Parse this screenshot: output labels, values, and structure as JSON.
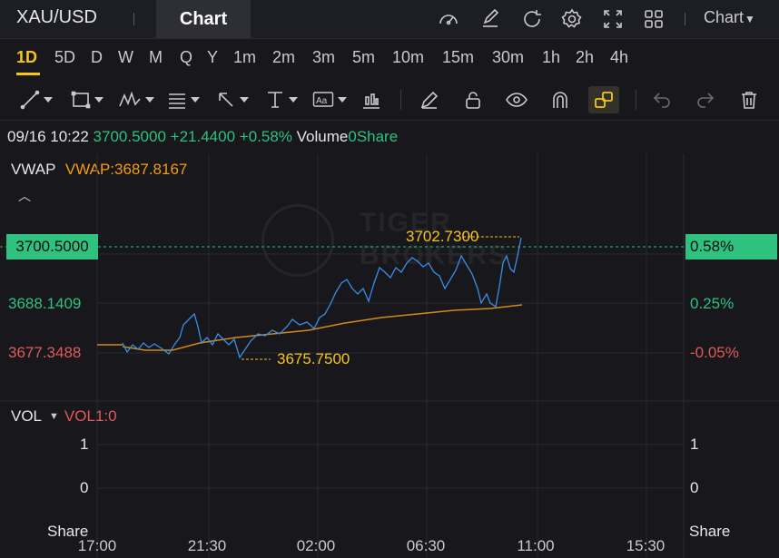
{
  "header": {
    "symbol": "XAU/USD",
    "active_tab": "Chart",
    "chart_menu": "Chart",
    "icons": [
      "gauge-icon",
      "edit-icon",
      "refresh-icon",
      "settings-icon",
      "fullscreen-icon",
      "layout-grid-icon"
    ]
  },
  "timeframes": [
    "1D",
    "5D",
    "D",
    "W",
    "M",
    "Q",
    "Y",
    "1m",
    "2m",
    "3m",
    "5m",
    "10m",
    "15m",
    "30m",
    "1h",
    "2h",
    "4h"
  ],
  "active_timeframe": "1D",
  "drawing_tools": [
    "line-tool-icon",
    "rectangle-tool-icon",
    "pattern-tool-icon",
    "fibonacci-tool-icon",
    "arrow-tool-icon",
    "measure-tool-icon",
    "text-tool-icon",
    "indicator-tool-icon",
    "pen-icon",
    "lock-icon",
    "eye-icon",
    "magnet-icon",
    "link-icon",
    "undo-icon",
    "redo-icon",
    "trash-icon"
  ],
  "quote": {
    "datetime": "09/16 10:22",
    "price": "3700.5000",
    "change": "+21.4400",
    "change_pct": "+0.58%",
    "volume_label": "Volume",
    "volume_value": "0Share"
  },
  "indicator": {
    "name": "VWAP",
    "value_text": "VWAP:3687.8167"
  },
  "price_axis": {
    "current_price": "3700.5000",
    "current_pct": "0.58%",
    "mid_price": "3688.1409",
    "mid_pct": "0.25%",
    "low_price": "3677.3488",
    "low_pct": "-0.05%"
  },
  "annotations": {
    "high": "3702.7300",
    "low": "3675.7500"
  },
  "volume_panel": {
    "label": "VOL",
    "indicator": "VOL1:0",
    "tick_1": "1",
    "tick_0": "0",
    "unit": "Share"
  },
  "x_axis": [
    "17:00",
    "21:30",
    "02:00",
    "06:30",
    "11:00",
    "15:30"
  ],
  "watermark": {
    "line1": "TIGER",
    "line2": "BROKERS"
  },
  "colors": {
    "up": "#2ec27e",
    "down": "#e05a5a",
    "price_line": "#3a8ee6",
    "vwap_line": "#d4891c",
    "accent": "#f5c518"
  }
}
